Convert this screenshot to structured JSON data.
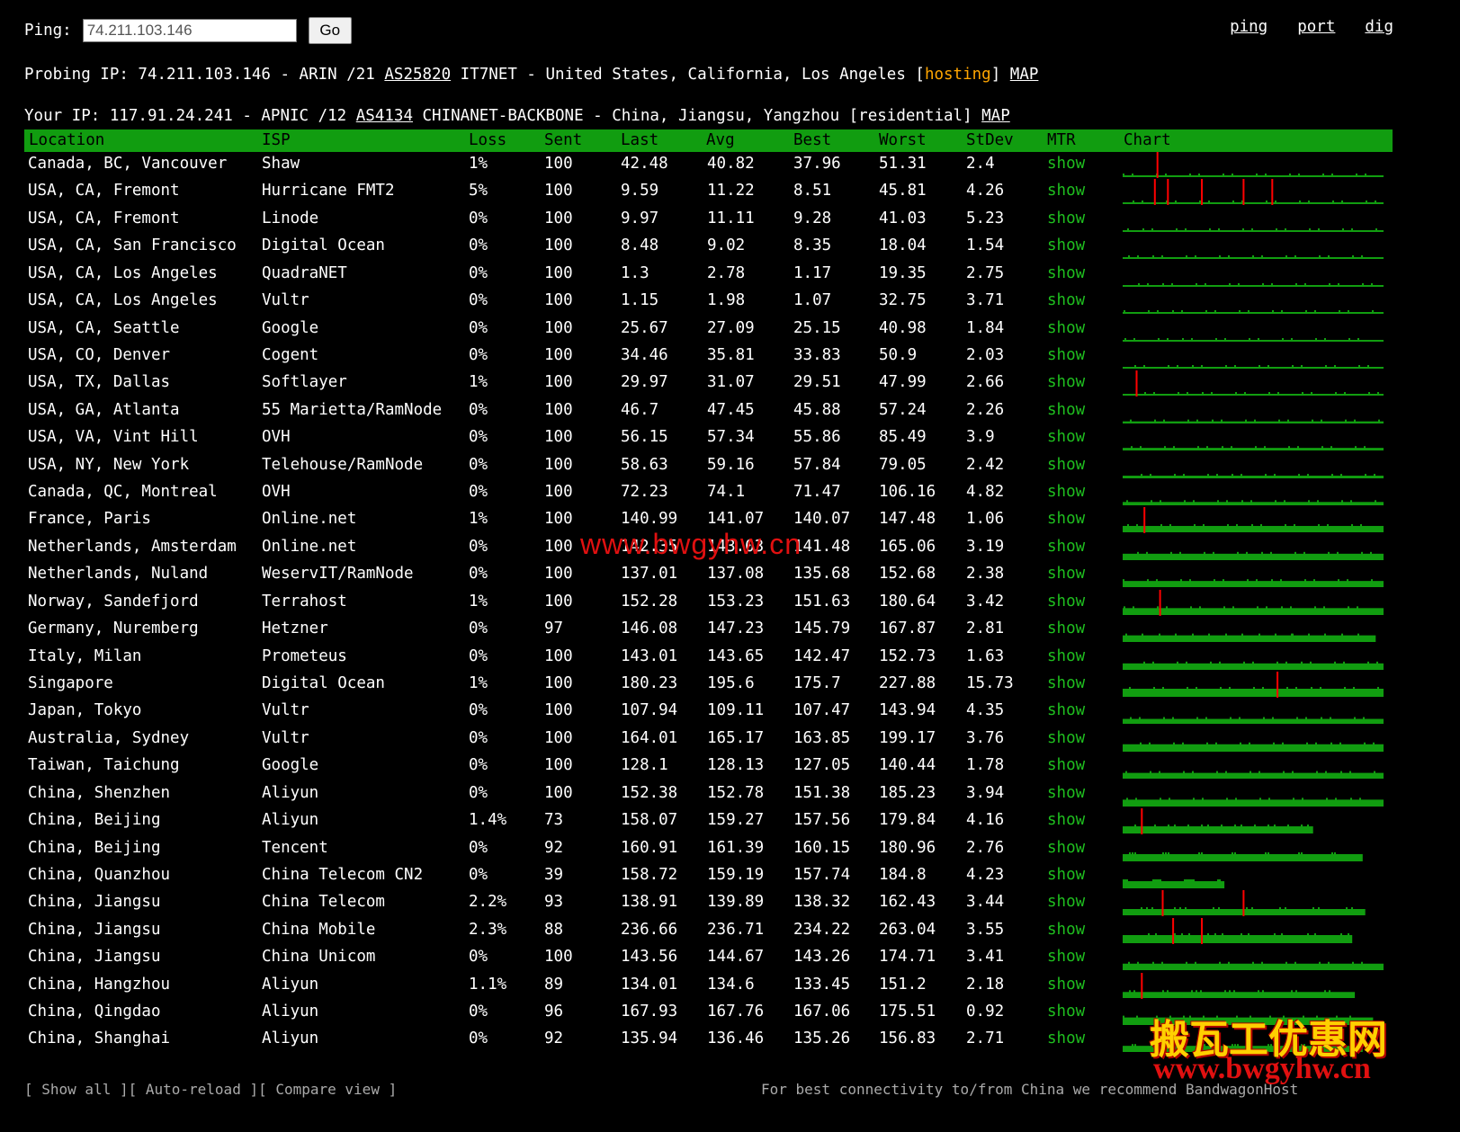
{
  "ping_form": {
    "label": "Ping:",
    "value": "74.211.103.146",
    "go": "Go"
  },
  "top_links": [
    "ping",
    "port",
    "dig"
  ],
  "probing": {
    "prefix": "Probing IP: 74.211.103.146 - ARIN /21 ",
    "asn": "AS25820",
    "mid": " IT7NET - United States, California, Los Angeles [",
    "type": "hosting",
    "close": "] ",
    "map": "MAP"
  },
  "your_ip": {
    "prefix": "Your IP: 117.91.24.241 - APNIC /12 ",
    "asn": "AS4134",
    "mid": " CHINANET-BACKBONE - China, Jiangsu, Yangzhou [residential] ",
    "map": "MAP"
  },
  "columns": [
    "Location",
    "ISP",
    "Loss",
    "Sent",
    "Last",
    "Avg",
    "Best",
    "Worst",
    "StDev",
    "MTR",
    "Chart"
  ],
  "rows": [
    {
      "location": "Canada, BC, Vancouver",
      "isp": "Shaw",
      "loss": "1%",
      "sent": "100",
      "last": "42.48",
      "avg": "40.82",
      "best": "37.96",
      "worst": "51.31",
      "stdev": "2.4",
      "mtr": "show"
    },
    {
      "location": "USA, CA, Fremont",
      "isp": "Hurricane FMT2",
      "loss": "5%",
      "sent": "100",
      "last": "9.59",
      "avg": "11.22",
      "best": "8.51",
      "worst": "45.81",
      "stdev": "4.26",
      "mtr": "show"
    },
    {
      "location": "USA, CA, Fremont",
      "isp": "Linode",
      "loss": "0%",
      "sent": "100",
      "last": "9.97",
      "avg": "11.11",
      "best": "9.28",
      "worst": "41.03",
      "stdev": "5.23",
      "mtr": "show"
    },
    {
      "location": "USA, CA, San Francisco",
      "isp": "Digital Ocean",
      "loss": "0%",
      "sent": "100",
      "last": "8.48",
      "avg": "9.02",
      "best": "8.35",
      "worst": "18.04",
      "stdev": "1.54",
      "mtr": "show"
    },
    {
      "location": "USA, CA, Los Angeles",
      "isp": "QuadraNET",
      "loss": "0%",
      "sent": "100",
      "last": "1.3",
      "avg": "2.78",
      "best": "1.17",
      "worst": "19.35",
      "stdev": "2.75",
      "mtr": "show"
    },
    {
      "location": "USA, CA, Los Angeles",
      "isp": "Vultr",
      "loss": "0%",
      "sent": "100",
      "last": "1.15",
      "avg": "1.98",
      "best": "1.07",
      "worst": "32.75",
      "stdev": "3.71",
      "mtr": "show"
    },
    {
      "location": "USA, CA, Seattle",
      "isp": "Google",
      "loss": "0%",
      "sent": "100",
      "last": "25.67",
      "avg": "27.09",
      "best": "25.15",
      "worst": "40.98",
      "stdev": "1.84",
      "mtr": "show"
    },
    {
      "location": "USA, CO, Denver",
      "isp": "Cogent",
      "loss": "0%",
      "sent": "100",
      "last": "34.46",
      "avg": "35.81",
      "best": "33.83",
      "worst": "50.9",
      "stdev": "2.03",
      "mtr": "show"
    },
    {
      "location": "USA, TX, Dallas",
      "isp": "Softlayer",
      "loss": "1%",
      "sent": "100",
      "last": "29.97",
      "avg": "31.07",
      "best": "29.51",
      "worst": "47.99",
      "stdev": "2.66",
      "mtr": "show"
    },
    {
      "location": "USA, GA, Atlanta",
      "isp": "55 Marietta/RamNode",
      "loss": "0%",
      "sent": "100",
      "last": "46.7",
      "avg": "47.45",
      "best": "45.88",
      "worst": "57.24",
      "stdev": "2.26",
      "mtr": "show"
    },
    {
      "location": "USA, VA, Vint Hill",
      "isp": "OVH",
      "loss": "0%",
      "sent": "100",
      "last": "56.15",
      "avg": "57.34",
      "best": "55.86",
      "worst": "85.49",
      "stdev": "3.9",
      "mtr": "show"
    },
    {
      "location": "USA, NY, New York",
      "isp": "Telehouse/RamNode",
      "loss": "0%",
      "sent": "100",
      "last": "58.63",
      "avg": "59.16",
      "best": "57.84",
      "worst": "79.05",
      "stdev": "2.42",
      "mtr": "show"
    },
    {
      "location": "Canada, QC, Montreal",
      "isp": "OVH",
      "loss": "0%",
      "sent": "100",
      "last": "72.23",
      "avg": "74.1",
      "best": "71.47",
      "worst": "106.16",
      "stdev": "4.82",
      "mtr": "show"
    },
    {
      "location": "France, Paris",
      "isp": "Online.net",
      "loss": "1%",
      "sent": "100",
      "last": "140.99",
      "avg": "141.07",
      "best": "140.07",
      "worst": "147.48",
      "stdev": "1.06",
      "mtr": "show"
    },
    {
      "location": "Netherlands, Amsterdam",
      "isp": "Online.net",
      "loss": "0%",
      "sent": "100",
      "last": "142.35",
      "avg": "143.03",
      "best": "141.48",
      "worst": "165.06",
      "stdev": "3.19",
      "mtr": "show"
    },
    {
      "location": "Netherlands, Nuland",
      "isp": "WeservIT/RamNode",
      "loss": "0%",
      "sent": "100",
      "last": "137.01",
      "avg": "137.08",
      "best": "135.68",
      "worst": "152.68",
      "stdev": "2.38",
      "mtr": "show"
    },
    {
      "location": "Norway, Sandefjord",
      "isp": "Terrahost",
      "loss": "1%",
      "sent": "100",
      "last": "152.28",
      "avg": "153.23",
      "best": "151.63",
      "worst": "180.64",
      "stdev": "3.42",
      "mtr": "show"
    },
    {
      "location": "Germany, Nuremberg",
      "isp": "Hetzner",
      "loss": "0%",
      "sent": "97",
      "last": "146.08",
      "avg": "147.23",
      "best": "145.79",
      "worst": "167.87",
      "stdev": "2.81",
      "mtr": "show"
    },
    {
      "location": "Italy, Milan",
      "isp": "Prometeus",
      "loss": "0%",
      "sent": "100",
      "last": "143.01",
      "avg": "143.65",
      "best": "142.47",
      "worst": "152.73",
      "stdev": "1.63",
      "mtr": "show"
    },
    {
      "location": "Singapore",
      "isp": "Digital Ocean",
      "loss": "1%",
      "sent": "100",
      "last": "180.23",
      "avg": "195.6",
      "best": "175.7",
      "worst": "227.88",
      "stdev": "15.73",
      "mtr": "show"
    },
    {
      "location": "Japan, Tokyo",
      "isp": "Vultr",
      "loss": "0%",
      "sent": "100",
      "last": "107.94",
      "avg": "109.11",
      "best": "107.47",
      "worst": "143.94",
      "stdev": "4.35",
      "mtr": "show"
    },
    {
      "location": "Australia, Sydney",
      "isp": "Vultr",
      "loss": "0%",
      "sent": "100",
      "last": "164.01",
      "avg": "165.17",
      "best": "163.85",
      "worst": "199.17",
      "stdev": "3.76",
      "mtr": "show"
    },
    {
      "location": "Taiwan, Taichung",
      "isp": "Google",
      "loss": "0%",
      "sent": "100",
      "last": "128.1",
      "avg": "128.13",
      "best": "127.05",
      "worst": "140.44",
      "stdev": "1.78",
      "mtr": "show"
    },
    {
      "location": "China, Shenzhen",
      "isp": "Aliyun",
      "loss": "0%",
      "sent": "100",
      "last": "152.38",
      "avg": "152.78",
      "best": "151.38",
      "worst": "185.23",
      "stdev": "3.94",
      "mtr": "show"
    },
    {
      "location": "China, Beijing",
      "isp": "Aliyun",
      "loss": "1.4%",
      "sent": "73",
      "last": "158.07",
      "avg": "159.27",
      "best": "157.56",
      "worst": "179.84",
      "stdev": "4.16",
      "mtr": "show"
    },
    {
      "location": "China, Beijing",
      "isp": "Tencent",
      "loss": "0%",
      "sent": "92",
      "last": "160.91",
      "avg": "161.39",
      "best": "160.15",
      "worst": "180.96",
      "stdev": "2.76",
      "mtr": "show"
    },
    {
      "location": "China, Quanzhou",
      "isp": "China Telecom CN2",
      "loss": "0%",
      "sent": "39",
      "last": "158.72",
      "avg": "159.19",
      "best": "157.74",
      "worst": "184.8",
      "stdev": "4.23",
      "mtr": "show"
    },
    {
      "location": "China, Jiangsu",
      "isp": "China Telecom",
      "loss": "2.2%",
      "sent": "93",
      "last": "138.91",
      "avg": "139.89",
      "best": "138.32",
      "worst": "162.43",
      "stdev": "3.44",
      "mtr": "show"
    },
    {
      "location": "China, Jiangsu",
      "isp": "China Mobile",
      "loss": "2.3%",
      "sent": "88",
      "last": "236.66",
      "avg": "236.71",
      "best": "234.22",
      "worst": "263.04",
      "stdev": "3.55",
      "mtr": "show"
    },
    {
      "location": "China, Jiangsu",
      "isp": "China Unicom",
      "loss": "0%",
      "sent": "100",
      "last": "143.56",
      "avg": "144.67",
      "best": "143.26",
      "worst": "174.71",
      "stdev": "3.41",
      "mtr": "show"
    },
    {
      "location": "China, Hangzhou",
      "isp": "Aliyun",
      "loss": "1.1%",
      "sent": "89",
      "last": "134.01",
      "avg": "134.6",
      "best": "133.45",
      "worst": "151.2",
      "stdev": "2.18",
      "mtr": "show"
    },
    {
      "location": "China, Qingdao",
      "isp": "Aliyun",
      "loss": "0%",
      "sent": "96",
      "last": "167.93",
      "avg": "167.76",
      "best": "167.06",
      "worst": "175.51",
      "stdev": "0.92",
      "mtr": "show"
    },
    {
      "location": "China, Shanghai",
      "isp": "Aliyun",
      "loss": "0%",
      "sent": "92",
      "last": "135.94",
      "avg": "136.46",
      "best": "135.26",
      "worst": "156.83",
      "stdev": "2.71",
      "mtr": "show"
    }
  ],
  "chart_data": {
    "type": "bar",
    "description_of_axes": "per-row sparkline: green bar length = packets sent (of 100), red ticks = lost packets",
    "max_sent": 100,
    "rows": [
      {
        "sent": 100,
        "loss_markers": [
          0.13
        ]
      },
      {
        "sent": 100,
        "loss_markers": [
          0.12,
          0.17,
          0.3,
          0.46,
          0.57
        ]
      },
      {
        "sent": 100,
        "loss_markers": []
      },
      {
        "sent": 100,
        "loss_markers": []
      },
      {
        "sent": 100,
        "loss_markers": []
      },
      {
        "sent": 100,
        "loss_markers": []
      },
      {
        "sent": 100,
        "loss_markers": []
      },
      {
        "sent": 100,
        "loss_markers": []
      },
      {
        "sent": 100,
        "loss_markers": [
          0.05
        ]
      },
      {
        "sent": 100,
        "loss_markers": []
      },
      {
        "sent": 100,
        "loss_markers": []
      },
      {
        "sent": 100,
        "loss_markers": []
      },
      {
        "sent": 100,
        "loss_markers": []
      },
      {
        "sent": 100,
        "loss_markers": [
          0.08
        ]
      },
      {
        "sent": 100,
        "loss_markers": []
      },
      {
        "sent": 100,
        "loss_markers": []
      },
      {
        "sent": 100,
        "loss_markers": [
          0.14
        ]
      },
      {
        "sent": 97,
        "loss_markers": []
      },
      {
        "sent": 100,
        "loss_markers": []
      },
      {
        "sent": 100,
        "loss_markers": [
          0.59
        ]
      },
      {
        "sent": 100,
        "loss_markers": []
      },
      {
        "sent": 100,
        "loss_markers": []
      },
      {
        "sent": 100,
        "loss_markers": []
      },
      {
        "sent": 100,
        "loss_markers": []
      },
      {
        "sent": 73,
        "loss_markers": [
          0.07
        ]
      },
      {
        "sent": 92,
        "loss_markers": []
      },
      {
        "sent": 39,
        "loss_markers": []
      },
      {
        "sent": 93,
        "loss_markers": [
          0.15,
          0.46
        ]
      },
      {
        "sent": 88,
        "loss_markers": [
          0.19,
          0.3
        ]
      },
      {
        "sent": 100,
        "loss_markers": []
      },
      {
        "sent": 89,
        "loss_markers": [
          0.07
        ]
      },
      {
        "sent": 96,
        "loss_markers": []
      },
      {
        "sent": 92,
        "loss_markers": []
      }
    ]
  },
  "bottom": {
    "checkboxes": "[ Show all ][ Auto-reload ][ Compare view ]",
    "note": "For best connectivity to/from China we recommend BandwagonHost"
  },
  "watermarks": {
    "center": "www.bwgyhw.cn",
    "logo_cn": "搬瓦工优惠网",
    "logo_url": "www.bwgyhw.cn"
  },
  "colors": {
    "header_green": "#119d10",
    "bar_green": "#119d10",
    "loss_red": "#ff0000",
    "show_green": "#1fbf1f",
    "hosting_orange": "#ffa500"
  }
}
